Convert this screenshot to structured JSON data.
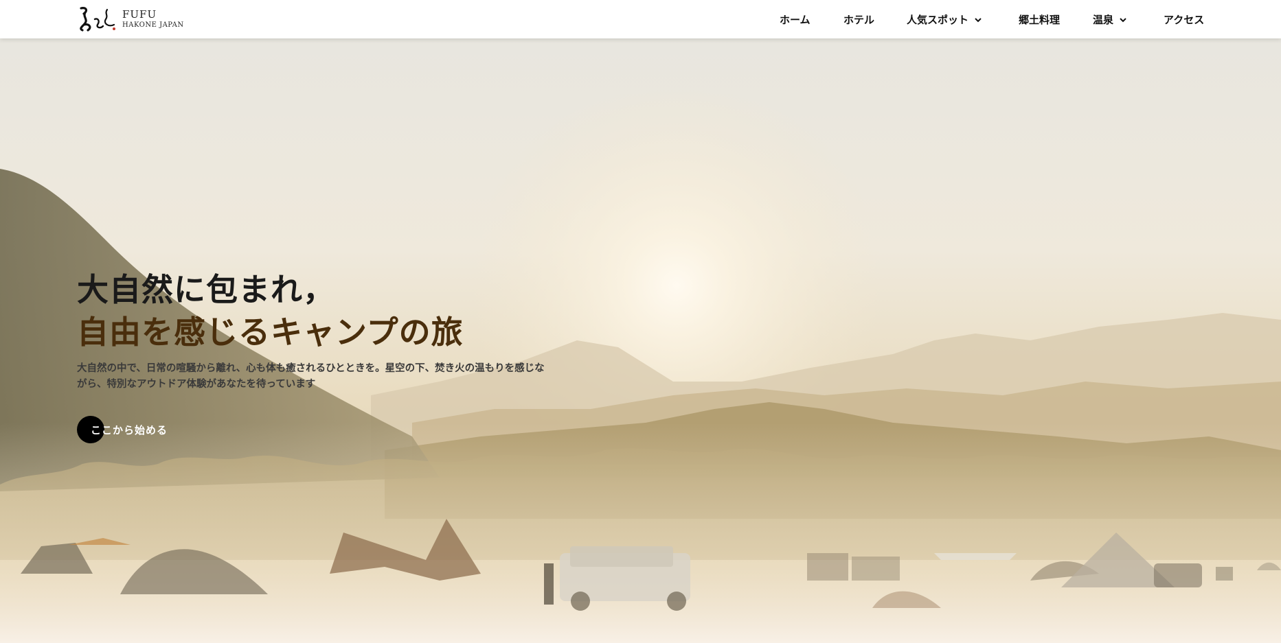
{
  "header": {
    "logo": {
      "name": "FUFU",
      "sub": "HAKONE JAPAN"
    },
    "nav": [
      {
        "label": "ホーム",
        "dropdown": false
      },
      {
        "label": "ホテル",
        "dropdown": false
      },
      {
        "label": "人気スポット",
        "dropdown": true
      },
      {
        "label": "郷土料理",
        "dropdown": false
      },
      {
        "label": "温泉",
        "dropdown": true
      },
      {
        "label": "アクセス",
        "dropdown": false
      }
    ]
  },
  "hero": {
    "headline_line1": "大自然に包まれ，",
    "headline_line2": "自由を感じるキャンプの旅",
    "description": "大自然の中で、日常の喧騒から離れ、心も体も癒されるひとときを。星空の下、焚き火の温もりを感じながら、特別なアウトドア体験があなたを待っています",
    "cta_label": "ここから始める",
    "background": "misty-campsite-sunrise-photo"
  },
  "colors": {
    "header_bg": "#ffffff",
    "headline_dark": "#1a1a1a",
    "headline_accent": "#4a2e0c",
    "cta_bg": "#000000",
    "cta_text": "#ffffff"
  }
}
